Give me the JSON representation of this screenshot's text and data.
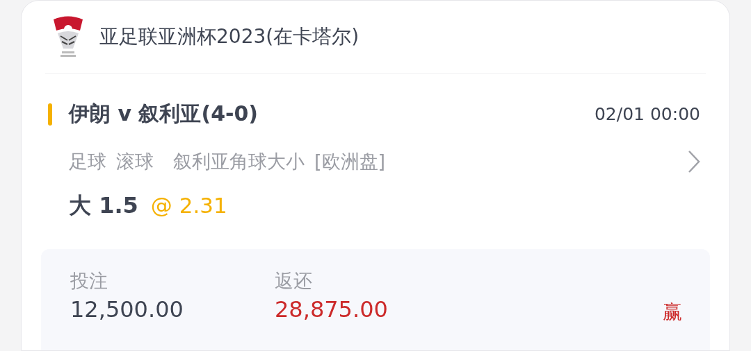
{
  "league": {
    "name": "亚足联亚洲杯2023(在卡塔尔)"
  },
  "match": {
    "title": "伊朗 v 叙利亚(4-0)",
    "time": "02/01 00:00",
    "tags": [
      "足球",
      "滚球",
      "叙利亚角球大小",
      "[欧洲盘]"
    ]
  },
  "selection": {
    "pick": "大 1.5",
    "odds": "@ 2.31"
  },
  "summary": [
    {
      "label": "投注",
      "value": "12,500.00",
      "kind": "stake"
    },
    {
      "label": "返还",
      "value": "28,875.00",
      "kind": "return"
    }
  ],
  "result": "赢"
}
